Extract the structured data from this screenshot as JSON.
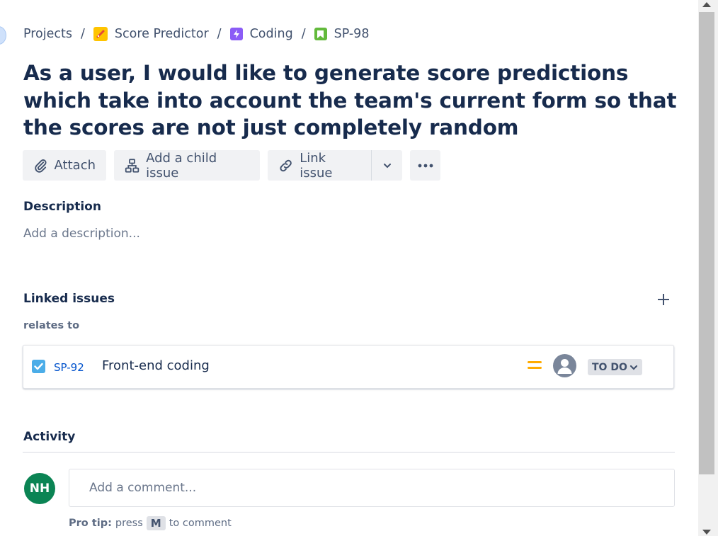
{
  "breadcrumbs": {
    "projects": "Projects",
    "project": "Score Predictor",
    "epic": "Coding",
    "issue": "SP-98",
    "separator": "/"
  },
  "issue": {
    "title": "As a user, I would like to generate score predictions which take into account the team's current form so that the scores are not just completely random"
  },
  "actions": {
    "attach": "Attach",
    "add_child": "Add a child issue",
    "link_issue": "Link issue"
  },
  "description": {
    "heading": "Description",
    "placeholder": "Add a description..."
  },
  "linked_issues": {
    "heading": "Linked issues",
    "relation": "relates to",
    "items": [
      {
        "key": "SP-92",
        "summary": "Front-end coding",
        "priority_icon": "medium-priority-icon",
        "priority_color": "#ffab00",
        "status": "TO DO"
      }
    ]
  },
  "activity": {
    "heading": "Activity",
    "avatar_initials": "NH",
    "avatar_color": "#0b8454",
    "comment_placeholder": "Add a comment...",
    "protip_label": "Pro tip:",
    "protip_pre": "press",
    "protip_key": "M",
    "protip_post": "to comment"
  },
  "colors": {
    "text_primary": "#172b4d",
    "text_secondary": "#42526e",
    "link": "#0052cc",
    "button_bg": "#f1f2f4",
    "task_icon": "#4bade8",
    "story_icon": "#63ba3c",
    "epic_icon": "#8b5cf6",
    "project_icon": "#ffc400"
  }
}
